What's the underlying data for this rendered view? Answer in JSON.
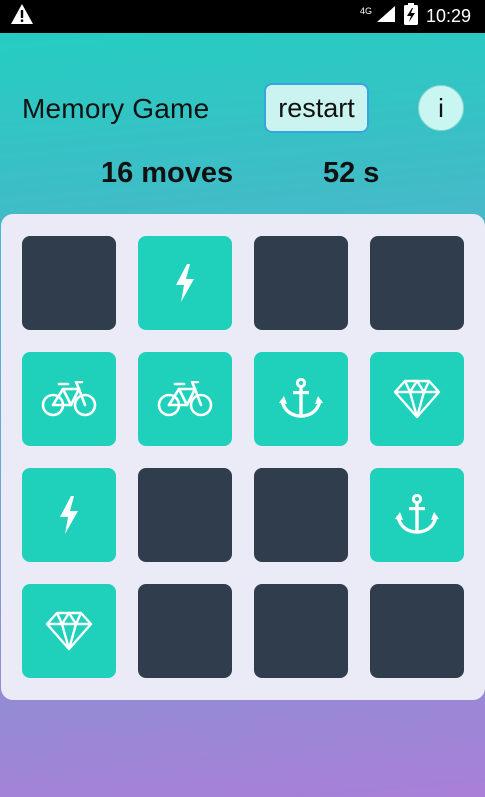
{
  "status_bar": {
    "network": "4G",
    "time": "10:29"
  },
  "header": {
    "title": "Memory Game",
    "restart_label": "restart",
    "info_label": "i"
  },
  "stats": {
    "moves": "16",
    "moves_unit": "moves",
    "seconds": "52",
    "seconds_unit": "s"
  },
  "colors": {
    "card_back": "#2f3d4c",
    "card_face": "#1fd0bb",
    "board": "#ebebf7"
  },
  "board": {
    "cards": [
      {
        "state": "hidden",
        "icon": ""
      },
      {
        "state": "shown",
        "icon": "bolt-icon"
      },
      {
        "state": "hidden",
        "icon": ""
      },
      {
        "state": "hidden",
        "icon": ""
      },
      {
        "state": "shown",
        "icon": "bicycle-icon"
      },
      {
        "state": "shown",
        "icon": "bicycle-icon"
      },
      {
        "state": "shown",
        "icon": "anchor-icon"
      },
      {
        "state": "shown",
        "icon": "diamond-icon"
      },
      {
        "state": "shown",
        "icon": "bolt-icon"
      },
      {
        "state": "hidden",
        "icon": ""
      },
      {
        "state": "hidden",
        "icon": ""
      },
      {
        "state": "shown",
        "icon": "anchor-icon"
      },
      {
        "state": "shown",
        "icon": "diamond-icon"
      },
      {
        "state": "hidden",
        "icon": ""
      },
      {
        "state": "hidden",
        "icon": ""
      },
      {
        "state": "hidden",
        "icon": ""
      }
    ]
  }
}
